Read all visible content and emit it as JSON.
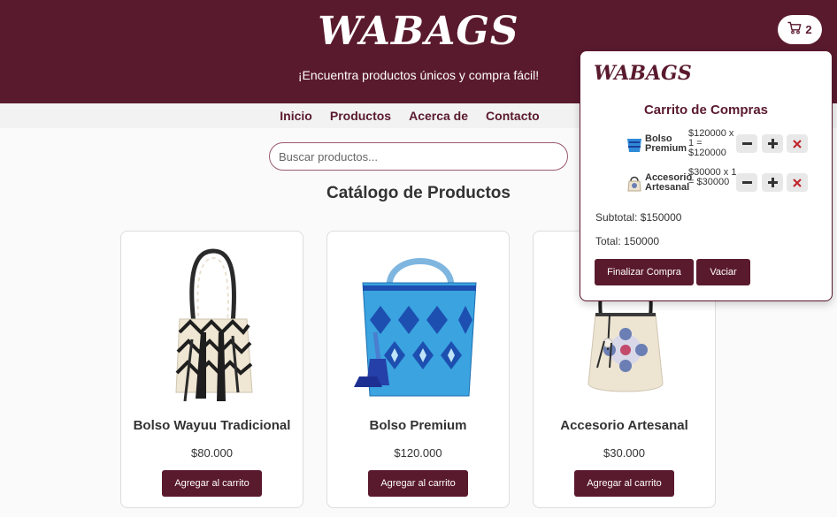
{
  "header": {
    "logo": "WABAGS",
    "tagline": "¡Encuentra productos únicos y compra fácil!",
    "cart_icon": "shopping-cart-icon",
    "cart_count": "2",
    "background_color": "#5a1a2e"
  },
  "nav": {
    "items": [
      "Inicio",
      "Productos",
      "Acerca de",
      "Contacto"
    ]
  },
  "search": {
    "placeholder": "Buscar productos...",
    "value": ""
  },
  "catalog": {
    "title": "Catálogo de Productos",
    "products": [
      {
        "name": "Bolso Wayuu Tradicional",
        "price": "$80.000",
        "button": "Agregar al carrito"
      },
      {
        "name": "Bolso Premium",
        "price": "$120.000",
        "button": "Agregar al carrito"
      },
      {
        "name": "Accesorio Artesanal",
        "price": "$30.000",
        "button": "Agregar al carrito"
      }
    ]
  },
  "cart_panel": {
    "logo": "WABAGS",
    "title": "Carrito de Compras",
    "items": [
      {
        "name": "Bolso Premium",
        "calc": "$120000 x 1 = $120000"
      },
      {
        "name": "Accesorio Artesanal",
        "calc": "$30000 x 1 = $30000"
      }
    ],
    "controls": {
      "decrease_icon": "minus-icon",
      "increase_icon": "plus-icon",
      "remove_icon": "close-icon"
    },
    "subtotal": "Subtotal: $150000",
    "total": "Total: 150000",
    "checkout_button": "Finalizar Compra",
    "empty_button": "Vaciar"
  }
}
